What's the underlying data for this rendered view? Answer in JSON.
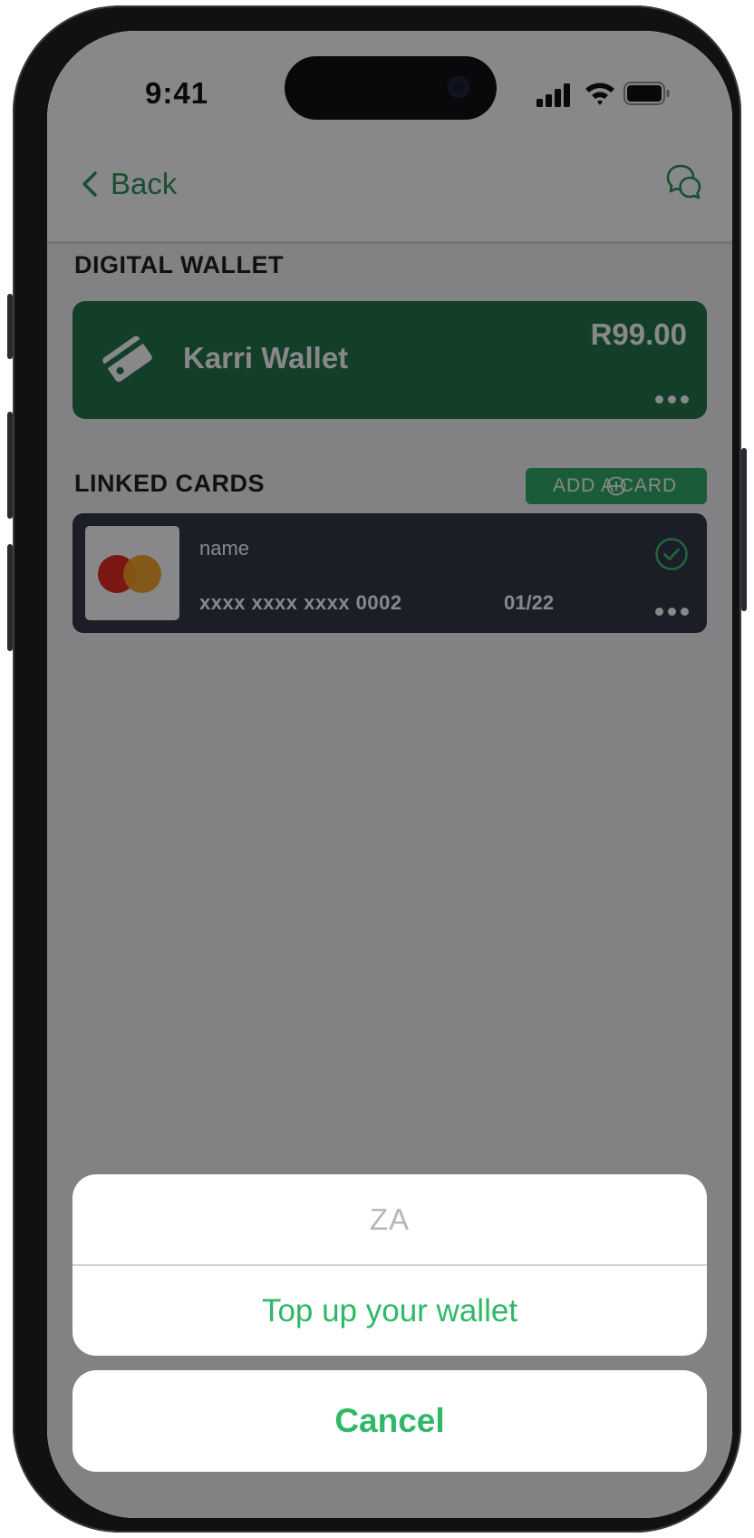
{
  "status_bar": {
    "time": "9:41"
  },
  "nav": {
    "back_label": "Back"
  },
  "digital_wallet": {
    "section_title": "DIGITAL WALLET",
    "wallet_name": "Karri Wallet",
    "balance": "R99.00"
  },
  "linked_cards": {
    "section_title": "LINKED CARDS",
    "add_card_label": "ADD A CARD",
    "cards": [
      {
        "name": "name",
        "number": "xxxx xxxx xxxx 0002",
        "expiry": "01/22"
      }
    ]
  },
  "action_sheet": {
    "title": "ZA",
    "action_label": "Top up your wallet",
    "cancel_label": "Cancel"
  },
  "colors": {
    "brand_green": "#1f8a4c",
    "wallet_card": "#156b3a",
    "button_green": "#22a65a",
    "action_green": "#2fb866",
    "card_dark": "#252938"
  }
}
